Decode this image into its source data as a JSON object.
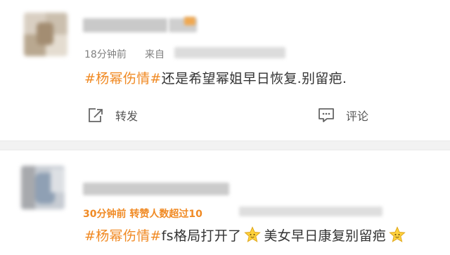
{
  "post1": {
    "time": "18分钟前",
    "source_label": "来自",
    "hashtag": "#杨幂伤情#",
    "text": "还是希望幂姐早日恢复.别留疤.",
    "actions": {
      "repost": "转发",
      "comment": "评论"
    }
  },
  "post2": {
    "time_repost": "30分钟前 转赞人数超过10",
    "hashtag": "#杨幂伤情#",
    "text_a": "fs格局打开了",
    "text_b": "美女早日康复别留疤",
    "emoji": "star-face-emoji"
  },
  "colors": {
    "accent": "#f08a24",
    "text": "#333333",
    "meta": "#808080"
  }
}
